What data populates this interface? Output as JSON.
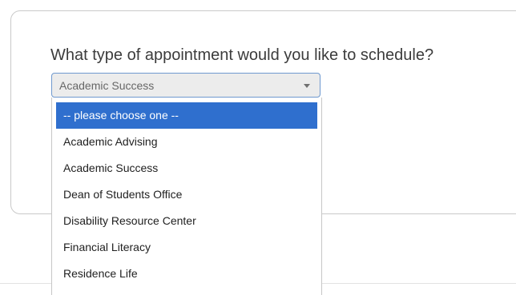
{
  "form": {
    "question": "What type of appointment would you like to schedule?",
    "select": {
      "value": "Academic Success",
      "arrow_icon": "caret-down-icon"
    },
    "dropdown": {
      "highlighted": "-- please choose one --",
      "options": [
        "-- please choose one --",
        "Academic Advising",
        "Academic Success",
        "Dean of Students Office",
        "Disability Resource Center",
        "Financial Literacy",
        "Residence Life"
      ]
    }
  },
  "colors": {
    "highlight": "#2f6fce",
    "select_border": "#6f99cf",
    "select_background": "#ececec"
  }
}
